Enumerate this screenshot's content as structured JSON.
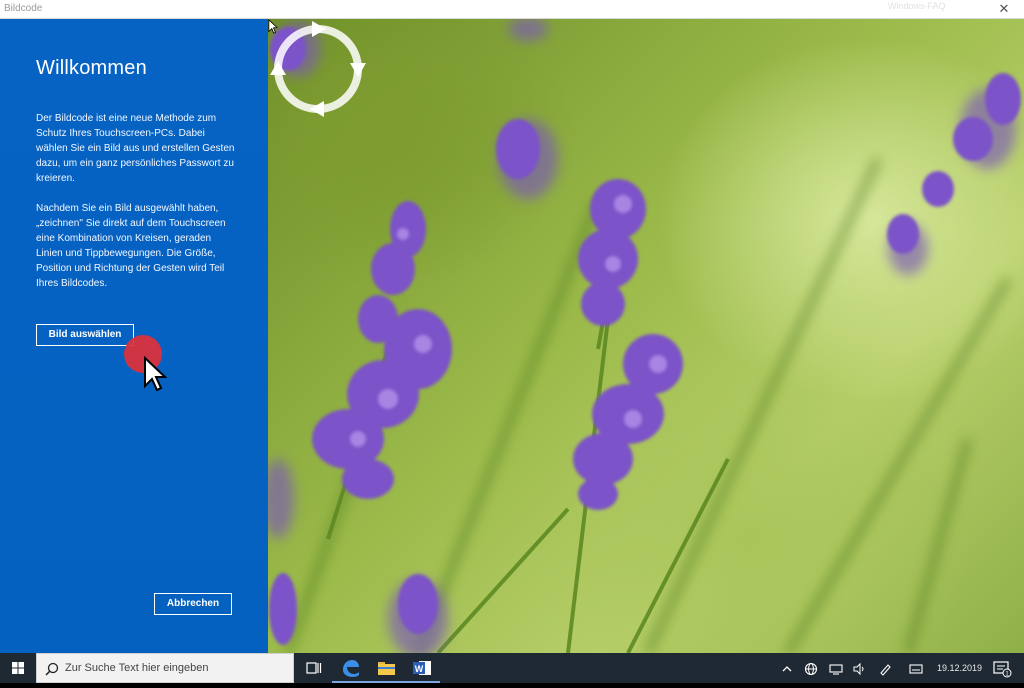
{
  "window": {
    "title": "Bildcode",
    "ghost_title": "Windows-FAQ",
    "close_glyph": "✕"
  },
  "panel": {
    "heading": "Willkommen",
    "paragraph1": "Der Bildcode ist eine neue Methode zum Schutz Ihres Touchscreen-PCs. Dabei wählen Sie ein Bild aus und erstellen Gesten dazu, um ein ganz persönliches Passwort zu kreieren.",
    "paragraph2": "Nachdem Sie ein Bild ausgewählt haben, „zeichnen\" Sie direkt auf dem Touchscreen eine Kombination von Kreisen, geraden Linien und Tippbewegungen. Die Größe, Position und Richtung der Gesten wird Teil Ihres Bildcodes.",
    "select_button": "Bild auswählen",
    "cancel_button": "Abbrechen"
  },
  "taskbar": {
    "search_placeholder": "Zur Suche Text hier eingeben",
    "date": "19.12.2019",
    "apps": [
      "task-view",
      "edge",
      "file-explorer",
      "word"
    ]
  },
  "colors": {
    "panel_blue": "#0563c1",
    "taskbar": "#1f2934",
    "click_marker": "#e0303a"
  }
}
